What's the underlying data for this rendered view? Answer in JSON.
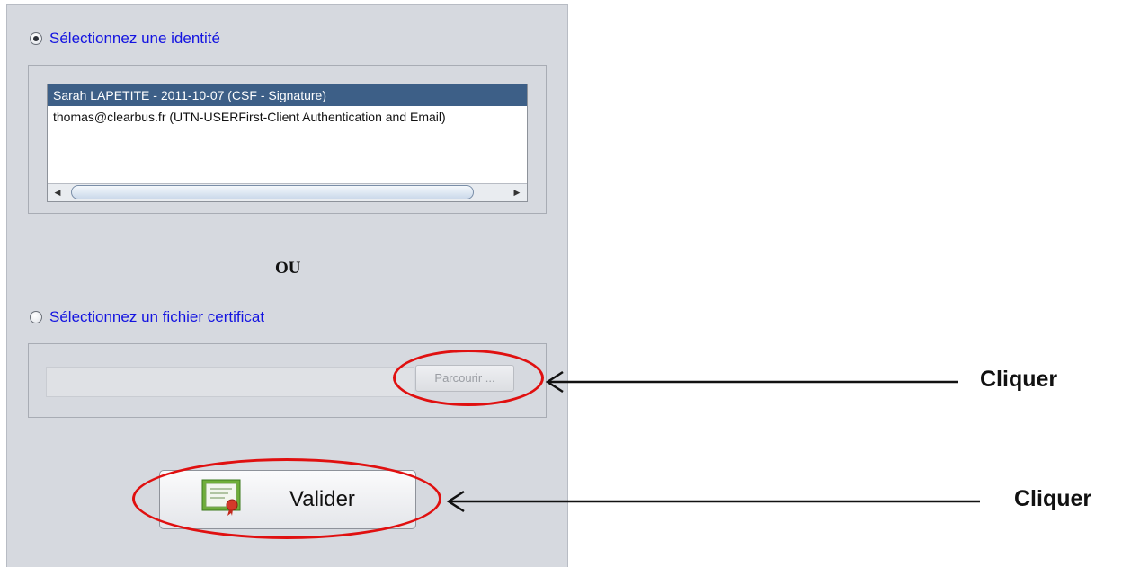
{
  "identity_section": {
    "radio_label": "Sélectionnez une identité",
    "selected": true,
    "list_items": [
      "Sarah LAPETITE - 2011-10-07 (CSF - Signature)",
      "thomas@clearbus.fr (UTN-USERFirst-Client Authentication and Email)"
    ],
    "selected_index": 0
  },
  "separator": {
    "text": "OU"
  },
  "file_section": {
    "radio_label": "Sélectionnez un fichier certificat",
    "selected": false,
    "file_path_value": "",
    "browse_label": "Parcourir ..."
  },
  "validate_button": {
    "label": "Valider",
    "icon": "certificate-icon"
  },
  "annotations": [
    {
      "text": "Cliquer"
    },
    {
      "text": "Cliquer"
    }
  ],
  "colors": {
    "panel_bg": "#d6d9df",
    "radio_label": "#1414e0",
    "selection_bg": "#3d5f87",
    "annotation_red": "#e01010"
  }
}
